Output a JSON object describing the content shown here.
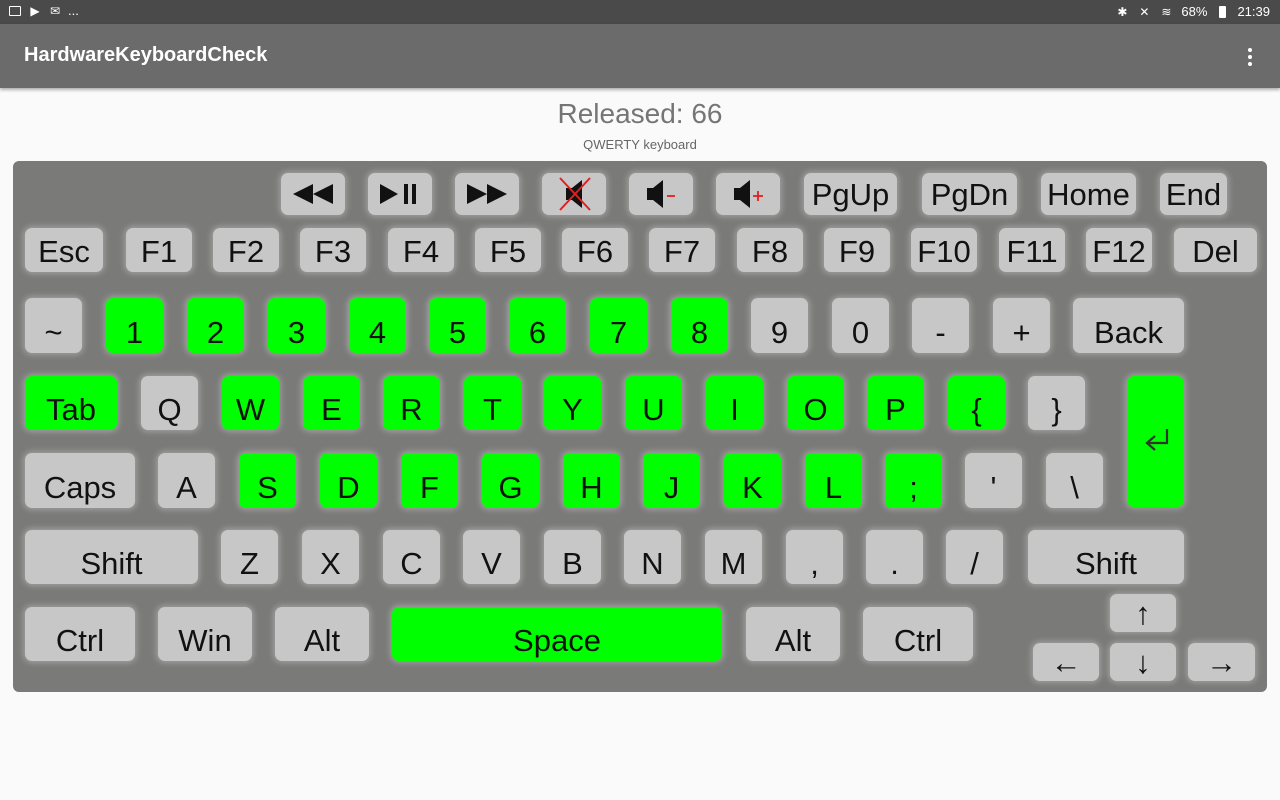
{
  "status_bar": {
    "left_icons": [
      "image-icon",
      "play-store-icon",
      "email-icon"
    ],
    "more": "...",
    "battery": "68%",
    "time": "21:39"
  },
  "app_bar": {
    "title": "HardwareKeyboardCheck",
    "menu_icon": "more-vert-icon"
  },
  "released_text": "Released: 66",
  "keyboard_type": "QWERTY keyboard",
  "colors": {
    "pressed": "#00ff00",
    "key": "#c7c7c7",
    "keyboard_bg": "#7a7a78",
    "app_bar": "#6b6b6b"
  },
  "keys": {
    "media": [
      {
        "name": "rewind",
        "icon": "rewind-icon"
      },
      {
        "name": "play-pause",
        "icon": "play-pause-icon"
      },
      {
        "name": "fast-forward",
        "icon": "fast-forward-icon"
      },
      {
        "name": "mute",
        "icon": "mute-icon"
      },
      {
        "name": "volume-down",
        "icon": "volume-down-icon"
      },
      {
        "name": "volume-up",
        "icon": "volume-up-icon"
      }
    ],
    "nav_top": [
      "PgUp",
      "PgDn",
      "Home",
      "End"
    ],
    "function_row": [
      "Esc",
      "F1",
      "F2",
      "F3",
      "F4",
      "F5",
      "F6",
      "F7",
      "F8",
      "F9",
      "F10",
      "F11",
      "F12",
      "Del"
    ],
    "number_row": [
      "~",
      "1",
      "2",
      "3",
      "4",
      "5",
      "6",
      "7",
      "8",
      "9",
      "0",
      "-",
      "+",
      "Back"
    ],
    "top_row": [
      "Tab",
      "Q",
      "W",
      "E",
      "R",
      "T",
      "Y",
      "U",
      "I",
      "O",
      "P",
      "{",
      "}"
    ],
    "home_row": [
      "Caps",
      "A",
      "S",
      "D",
      "F",
      "G",
      "H",
      "J",
      "K",
      "L",
      ";",
      "'",
      "\\"
    ],
    "bottom_row": [
      "Shift",
      "Z",
      "X",
      "C",
      "V",
      "B",
      "N",
      "M",
      ",",
      ".",
      "/",
      "Shift"
    ],
    "space_row": [
      "Ctrl",
      "Win",
      "Alt",
      "Space",
      "Alt",
      "Ctrl"
    ],
    "arrows": {
      "up": "↑",
      "left": "←",
      "down": "↓",
      "right": "→"
    },
    "enter_icon": "enter-icon",
    "pressed": [
      "1",
      "2",
      "3",
      "4",
      "5",
      "6",
      "7",
      "8",
      "Tab",
      "W",
      "E",
      "R",
      "T",
      "Y",
      "U",
      "I",
      "O",
      "P",
      "{",
      "S",
      "D",
      "F",
      "G",
      "H",
      "J",
      "K",
      "L",
      ";",
      "Space",
      "Enter"
    ]
  }
}
